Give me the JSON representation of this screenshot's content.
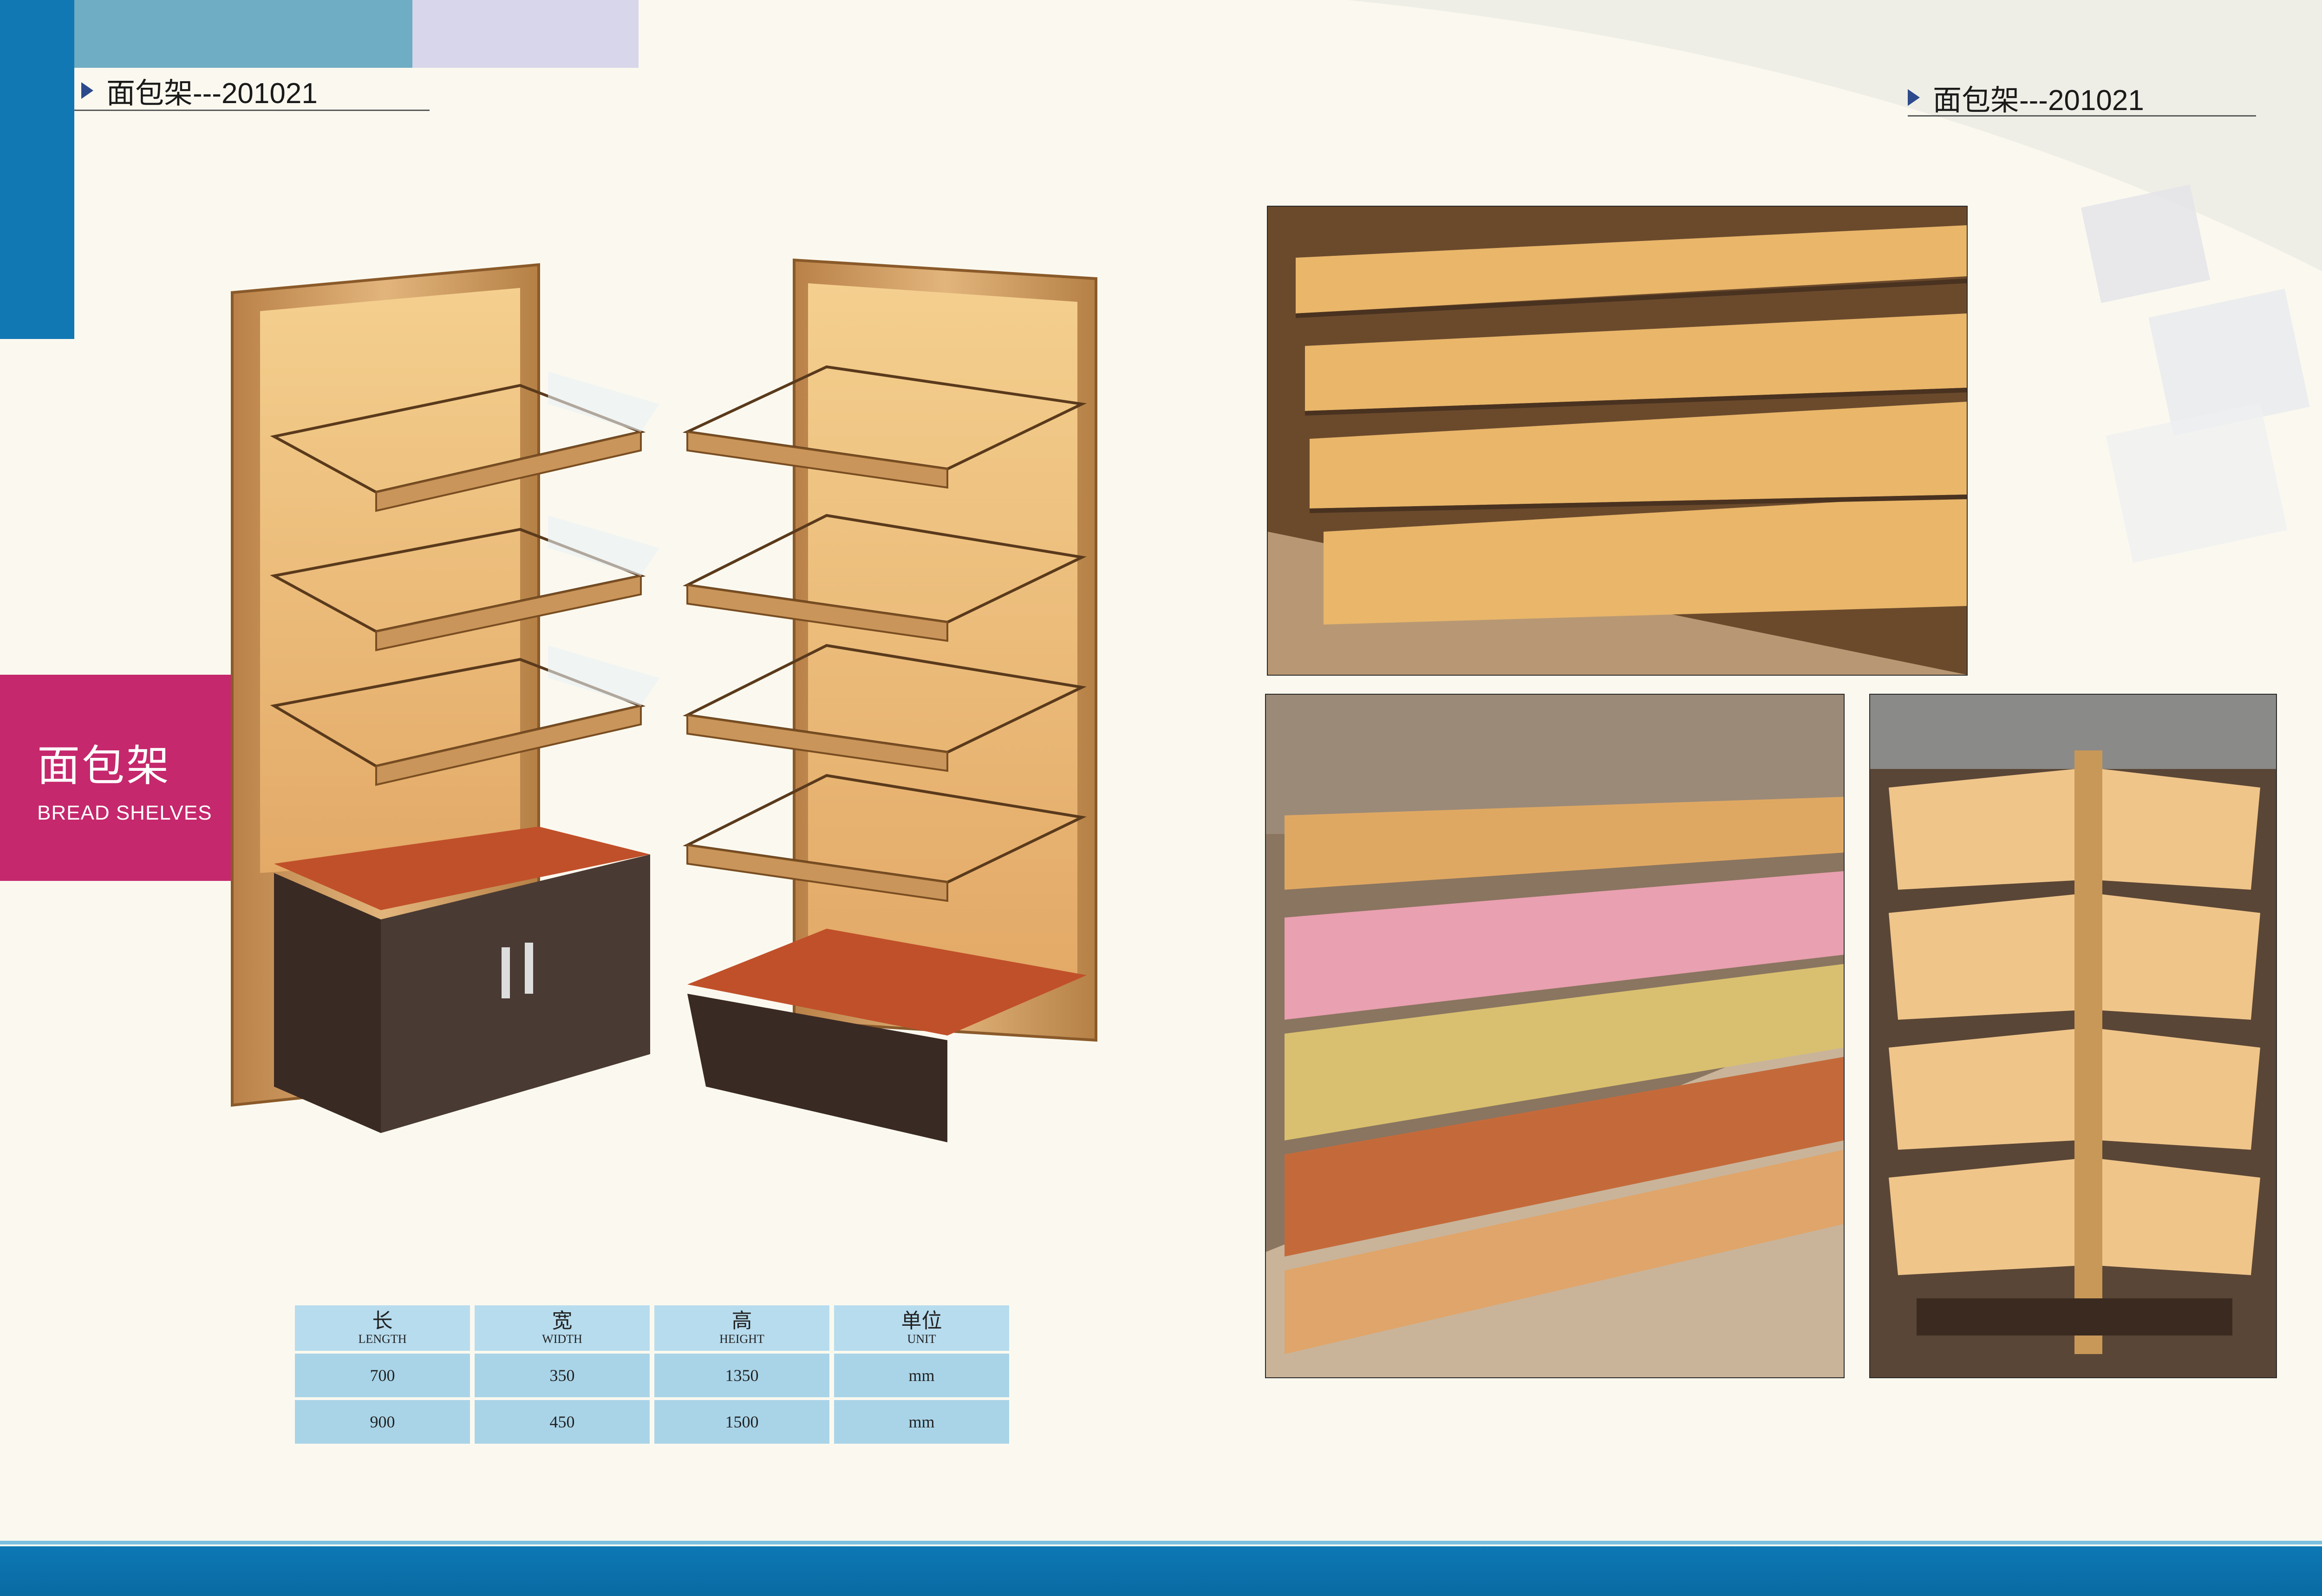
{
  "header_left": {
    "title": "面包架---201021"
  },
  "header_right": {
    "title": "面包架---201021"
  },
  "category": {
    "title_zh": "面包架",
    "title_en": "BREAD  SHELVES"
  },
  "spec_table": {
    "headers": [
      {
        "zh": "长",
        "en": "LENGTH"
      },
      {
        "zh": "宽",
        "en": "WIDTH"
      },
      {
        "zh": "高",
        "en": "HEIGHT"
      },
      {
        "zh": "单位",
        "en": "UNIT"
      }
    ],
    "rows": [
      [
        "700",
        "350",
        "1350",
        "mm"
      ],
      [
        "900",
        "450",
        "1500",
        "mm"
      ]
    ]
  },
  "colors": {
    "background": "#fbf9ef",
    "accent_blue": "#1178b4",
    "accent_pink": "#c5286c",
    "table_cell": "#a9d4e8",
    "wood": "#c9955a"
  }
}
